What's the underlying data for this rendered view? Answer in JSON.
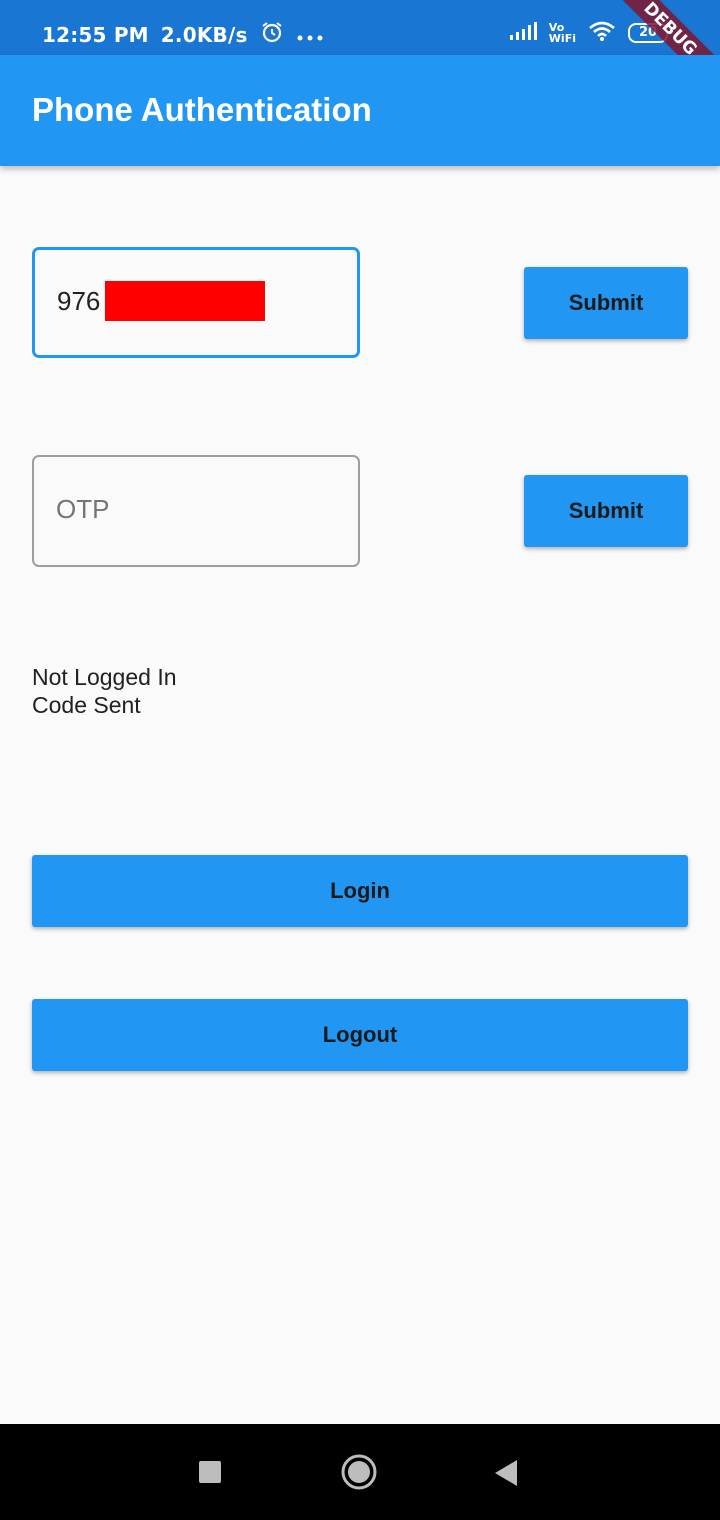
{
  "status_bar": {
    "time": "12:55 PM",
    "net_speed": "2.0KB/s",
    "vo_wifi_top": "Vo",
    "vo_wifi_bottom": "WiFi",
    "battery": "20",
    "debug_banner": "DEBUG",
    "icons": [
      "alarm-icon",
      "more-dots-icon",
      "signal-icon",
      "vowifi-icon",
      "wifi-icon",
      "battery-icon"
    ]
  },
  "app_bar": {
    "title": "Phone Authentication",
    "color": "#2196f3"
  },
  "phone_field": {
    "value": "976"
  },
  "otp_field": {
    "placeholder": "OTP"
  },
  "buttons": {
    "submit_phone": "Submit",
    "submit_otp": "Submit",
    "login": "Login",
    "logout": "Logout"
  },
  "status": {
    "line1": "Not Logged In",
    "line2": "Code Sent"
  },
  "nav_bar": {
    "icons": [
      "recents-square-icon",
      "home-circle-icon",
      "back-triangle-icon"
    ]
  }
}
